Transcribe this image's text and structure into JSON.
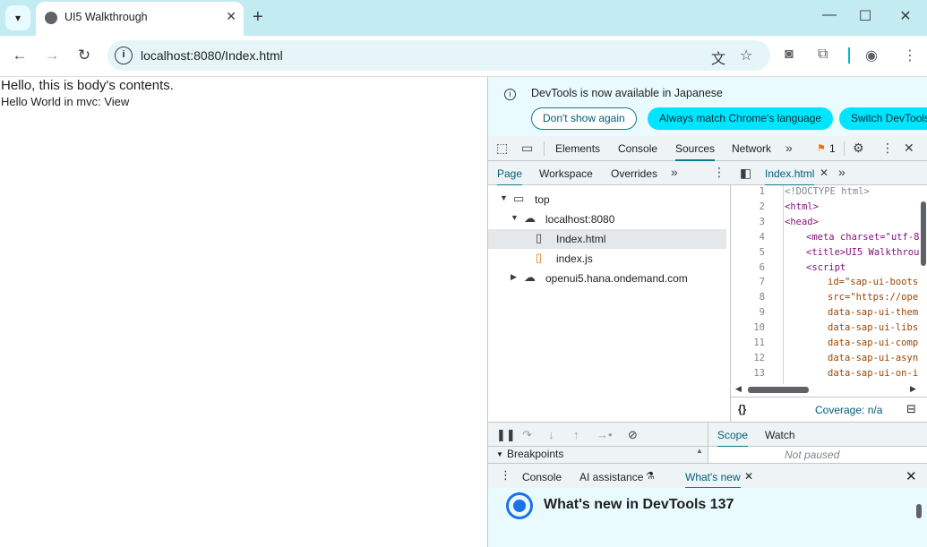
{
  "browser": {
    "tab_title": "UI5 Walkthrough",
    "tab_close": "✕",
    "new_tab": "+",
    "url": "localhost:8080/Index.html",
    "window_buttons": [
      "—",
      "☐",
      "✕"
    ]
  },
  "page": {
    "line1": "Hello, this is body's contents.",
    "line2": "Hello World in mvc: View"
  },
  "devtools": {
    "infobar": {
      "message": "DevTools is now available in Japanese",
      "dont_show": "Don't show again",
      "always_match": "Always match Chrome's language",
      "switch": "Switch DevTools"
    },
    "tabs": [
      "Elements",
      "Console",
      "Sources",
      "Network"
    ],
    "issues_count": "1",
    "sources_subtabs": [
      "Page",
      "Workspace",
      "Overrides"
    ],
    "tree": [
      {
        "label": "top"
      },
      {
        "label": "localhost:8080"
      },
      {
        "label": "Index.html"
      },
      {
        "label": "index.js"
      },
      {
        "label": "openui5.hana.ondemand.com"
      }
    ],
    "editor_file": "Index.html",
    "code_lines": [
      {
        "n": "1",
        "text": "<!DOCTYPE html>"
      },
      {
        "n": "2",
        "text": "<html>"
      },
      {
        "n": "3",
        "text": "<head>"
      },
      {
        "n": "4",
        "text": "<meta charset=\"utf-8"
      },
      {
        "n": "5",
        "text": "<title>UI5 Walkthrou"
      },
      {
        "n": "6",
        "text": "<script"
      },
      {
        "n": "7",
        "text": "id=\"sap-ui-boots"
      },
      {
        "n": "8",
        "text": "src=\"https://ope"
      },
      {
        "n": "9",
        "text": "data-sap-ui-them"
      },
      {
        "n": "10",
        "text": "data-sap-ui-libs"
      },
      {
        "n": "11",
        "text": "data-sap-ui-comp"
      },
      {
        "n": "12",
        "text": "data-sap-ui-asyn"
      },
      {
        "n": "13",
        "text": "data-sap-ui-on-i"
      }
    ],
    "coverage": "Coverage: n/a",
    "scope_tabs": [
      "Scope",
      "Watch"
    ],
    "breakpoints": "Breakpoints",
    "not_paused": "Not paused",
    "drawer_tabs": [
      "Console",
      "AI assistance",
      "What's new"
    ],
    "whats_new_title": "What's new in DevTools 137"
  }
}
